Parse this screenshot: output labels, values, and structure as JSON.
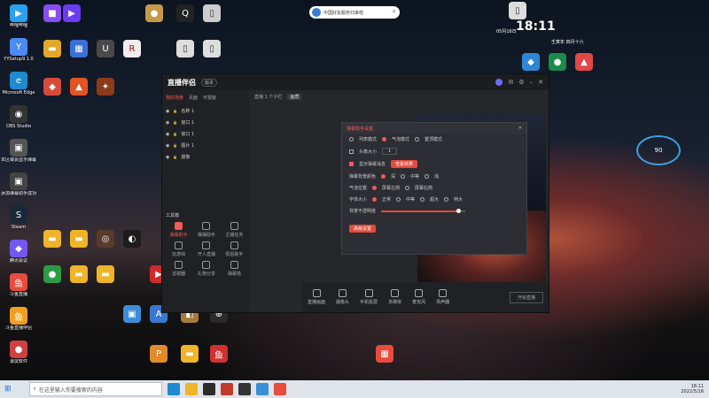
{
  "top_widget": {
    "label": "中国好友服务归来啦"
  },
  "clock": {
    "time": "18:11",
    "date": "05月16日",
    "weekday_info": "壬寅年 四月十六"
  },
  "desktop_icons_left": [
    {
      "label": "哔哩哔哩",
      "color": "#2aa0f0",
      "glyph": "▶"
    },
    {
      "label": "YYSetup9.1.0",
      "color": "#4c8bf5",
      "glyph": "Y"
    },
    {
      "label": "Microsoft Edge",
      "color": "#1e8ad0",
      "glyph": "e"
    },
    {
      "label": "OBS Studio",
      "color": "#333",
      "glyph": "◉"
    },
    {
      "label": "本区域会显示弹幕消息和礼物",
      "color": "#555",
      "glyph": "▣"
    },
    {
      "label": "添加弹幕助手成功",
      "color": "#444",
      "glyph": "▣"
    },
    {
      "label": "Steam",
      "color": "#1b2838",
      "glyph": "S"
    },
    {
      "label": "腾讯会议",
      "color": "#7456f0",
      "glyph": "◆"
    },
    {
      "label": "斗鱼直播",
      "color": "#e74c3c",
      "glyph": "鱼"
    },
    {
      "label": "斗鱼直播伴侣",
      "color": "#f0a020",
      "glyph": "鱼"
    },
    {
      "label": "录屏软件",
      "color": "#d04040",
      "glyph": "●"
    }
  ],
  "window": {
    "title": "直播伴侣",
    "edition": "版本",
    "side_tabs": [
      "我的场景",
      "页面",
      "可视窗"
    ],
    "sources": [
      "名称 1",
      "窗口 1",
      "窗口 1",
      "图片 1",
      "摄像"
    ],
    "tools_label": "工具箱",
    "tools": [
      "弹幕助手",
      "摆摆助手",
      "主播任务",
      "玩游戏",
      "开人直播",
      "情侣助手",
      "滤镜器",
      "礼物分享",
      "弹幕墙"
    ],
    "center_tabs": [
      "直播 1 个子栏",
      "画质"
    ],
    "bottom_buttons": [
      "直播画面",
      "摄像头",
      "手机投屏",
      "多媒体",
      "麦克风",
      "扬声器"
    ],
    "start_button": "开始直播"
  },
  "dialog": {
    "title": "弹幕助手设置",
    "modes": [
      "列表模式",
      "气泡模式",
      "置顶模式"
    ],
    "font_label": "头像大小",
    "font_value": "1",
    "show_barrage_label": "显示弹幕消息",
    "red_button": "查看效果",
    "bg_label": "弹幕背景颜色",
    "bg_options": [
      "深",
      "中等",
      "浅"
    ],
    "position_label": "气泡位置",
    "position_options": [
      "屏幕左侧",
      "屏幕右侧"
    ],
    "size_label": "字体大小",
    "size_options": [
      "正常",
      "中等",
      "超大",
      "特大"
    ],
    "opacity_label": "背景不透明度",
    "opacity_value": 0.92,
    "advanced_button": "高级设置"
  },
  "taskbar": {
    "search_placeholder": "在这里输入你要搜索的内容",
    "time": "18:11",
    "date": "2022/5/16"
  }
}
